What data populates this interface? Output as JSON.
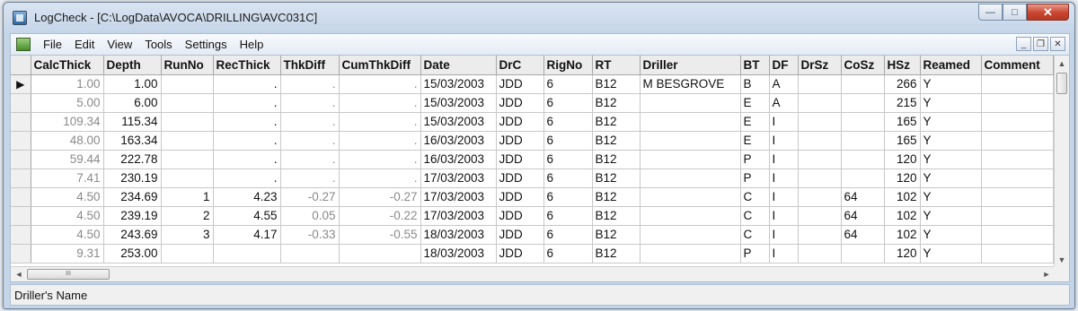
{
  "window": {
    "title": "LogCheck - [C:\\LogData\\AVOCA\\DRILLING\\AVC031C]",
    "caption_buttons": {
      "minimize": "—",
      "maximize": "□",
      "close": "✕"
    }
  },
  "menubar": {
    "items": [
      "File",
      "Edit",
      "View",
      "Tools",
      "Settings",
      "Help"
    ],
    "mdi_buttons": {
      "minimize": "_",
      "restore": "❐",
      "close": "✕"
    }
  },
  "grid": {
    "columns": [
      "CalcThick",
      "Depth",
      "RunNo",
      "RecThick",
      "ThkDiff",
      "CumThkDiff",
      "Date",
      "DrC",
      "RigNo",
      "RT",
      "Driller",
      "BT",
      "DF",
      "DrSz",
      "CoSz",
      "HSz",
      "Reamed",
      "Comment"
    ],
    "current_row_marker": "▶",
    "rows": [
      [
        "1.00",
        "1.00",
        "",
        ".",
        ".",
        ".",
        "15/03/2003",
        "JDD",
        "6",
        "B12",
        "M BESGROVE",
        "B",
        "A",
        "",
        "",
        "266",
        "Y",
        ""
      ],
      [
        "5.00",
        "6.00",
        "",
        ".",
        ".",
        ".",
        "15/03/2003",
        "JDD",
        "6",
        "B12",
        "",
        "E",
        "A",
        "",
        "",
        "215",
        "Y",
        ""
      ],
      [
        "109.34",
        "115.34",
        "",
        ".",
        ".",
        ".",
        "15/03/2003",
        "JDD",
        "6",
        "B12",
        "",
        "E",
        "I",
        "",
        "",
        "165",
        "Y",
        ""
      ],
      [
        "48.00",
        "163.34",
        "",
        ".",
        ".",
        ".",
        "16/03/2003",
        "JDD",
        "6",
        "B12",
        "",
        "E",
        "I",
        "",
        "",
        "165",
        "Y",
        ""
      ],
      [
        "59.44",
        "222.78",
        "",
        ".",
        ".",
        ".",
        "16/03/2003",
        "JDD",
        "6",
        "B12",
        "",
        "P",
        "I",
        "",
        "",
        "120",
        "Y",
        ""
      ],
      [
        "7.41",
        "230.19",
        "",
        ".",
        ".",
        ".",
        "17/03/2003",
        "JDD",
        "6",
        "B12",
        "",
        "P",
        "I",
        "",
        "",
        "120",
        "Y",
        ""
      ],
      [
        "4.50",
        "234.69",
        "1",
        "4.23",
        "-0.27",
        "-0.27",
        "17/03/2003",
        "JDD",
        "6",
        "B12",
        "",
        "C",
        "I",
        "",
        "64",
        "102",
        "Y",
        ""
      ],
      [
        "4.50",
        "239.19",
        "2",
        "4.55",
        "0.05",
        "-0.22",
        "17/03/2003",
        "JDD",
        "6",
        "B12",
        "",
        "C",
        "I",
        "",
        "64",
        "102",
        "Y",
        ""
      ],
      [
        "4.50",
        "243.69",
        "3",
        "4.17",
        "-0.33",
        "-0.55",
        "18/03/2003",
        "JDD",
        "6",
        "B12",
        "",
        "C",
        "I",
        "",
        "64",
        "102",
        "Y",
        ""
      ],
      [
        "9.31",
        "253.00",
        "",
        "",
        "",
        "",
        "18/03/2003",
        "JDD",
        "6",
        "B12",
        "",
        "P",
        "I",
        "",
        "",
        "120",
        "Y",
        ""
      ]
    ]
  },
  "scrollbars": {
    "up": "▲",
    "down": "▼",
    "left": "◄",
    "right": "►",
    "grip": "III"
  },
  "status": {
    "text": "Driller's Name"
  }
}
